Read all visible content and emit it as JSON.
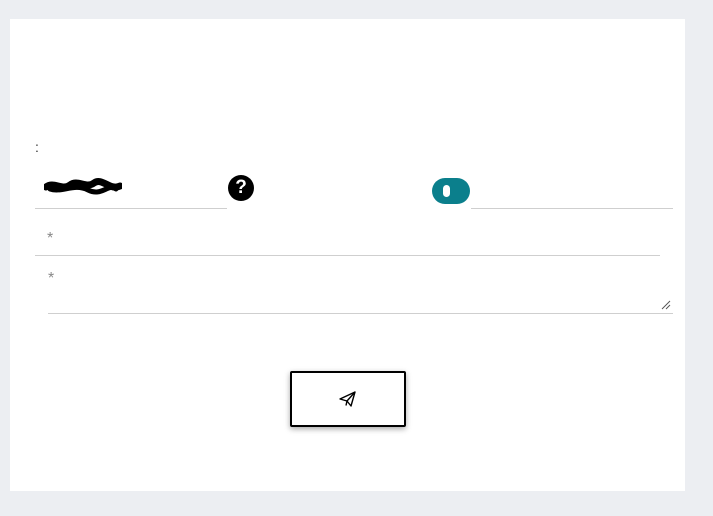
{
  "form": {
    "colon_label": ":",
    "help_glyph": "?",
    "field_1": {
      "required_mark": "*",
      "value": "",
      "placeholder": ""
    },
    "field_2": {
      "required_mark": "*",
      "value": "",
      "placeholder": ""
    },
    "toggle": {
      "state": "on",
      "color": "#0b7f8c"
    },
    "submit": {
      "icon": "send-paper-plane-icon"
    }
  },
  "colors": {
    "background": "#eceef2",
    "card": "#ffffff",
    "accent": "#0b7f8c"
  }
}
